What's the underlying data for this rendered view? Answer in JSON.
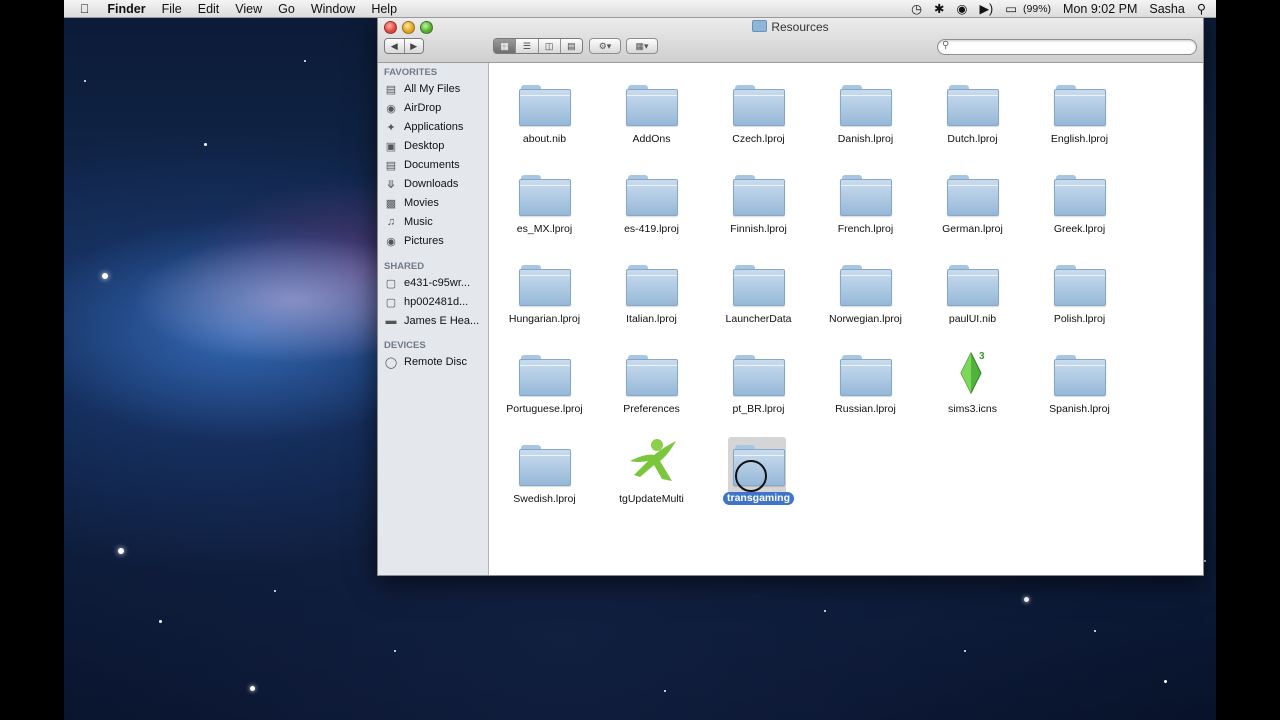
{
  "menubar": {
    "app": "Finder",
    "menus": [
      "File",
      "Edit",
      "View",
      "Go",
      "Window",
      "Help"
    ],
    "battery": "(99%)",
    "clock": "Mon 9:02 PM",
    "user": "Sasha"
  },
  "window": {
    "title": "Resources",
    "view_mode": "icon"
  },
  "sidebar": {
    "favorites_header": "FAVORITES",
    "favorites": [
      {
        "label": "All My Files",
        "icon": "all-files-icon"
      },
      {
        "label": "AirDrop",
        "icon": "airdrop-icon"
      },
      {
        "label": "Applications",
        "icon": "applications-icon"
      },
      {
        "label": "Desktop",
        "icon": "desktop-icon"
      },
      {
        "label": "Documents",
        "icon": "documents-icon"
      },
      {
        "label": "Downloads",
        "icon": "downloads-icon"
      },
      {
        "label": "Movies",
        "icon": "movies-icon"
      },
      {
        "label": "Music",
        "icon": "music-icon"
      },
      {
        "label": "Pictures",
        "icon": "pictures-icon"
      }
    ],
    "shared_header": "SHARED",
    "shared": [
      {
        "label": "e431-c95wr...",
        "icon": "computer-icon"
      },
      {
        "label": "hp002481d...",
        "icon": "computer-icon"
      },
      {
        "label": "James E Hea...",
        "icon": "server-icon"
      }
    ],
    "devices_header": "DEVICES",
    "devices": [
      {
        "label": "Remote Disc",
        "icon": "disc-icon"
      }
    ]
  },
  "files": [
    {
      "name": "about.nib",
      "kind": "folder"
    },
    {
      "name": "AddOns",
      "kind": "folder"
    },
    {
      "name": "Czech.lproj",
      "kind": "folder"
    },
    {
      "name": "Danish.lproj",
      "kind": "folder"
    },
    {
      "name": "Dutch.lproj",
      "kind": "folder"
    },
    {
      "name": "English.lproj",
      "kind": "folder"
    },
    {
      "name": "es_MX.lproj",
      "kind": "folder"
    },
    {
      "name": "es-419.lproj",
      "kind": "folder"
    },
    {
      "name": "Finnish.lproj",
      "kind": "folder"
    },
    {
      "name": "French.lproj",
      "kind": "folder"
    },
    {
      "name": "German.lproj",
      "kind": "folder"
    },
    {
      "name": "Greek.lproj",
      "kind": "folder"
    },
    {
      "name": "Hungarian.lproj",
      "kind": "folder"
    },
    {
      "name": "Italian.lproj",
      "kind": "folder"
    },
    {
      "name": "LauncherData",
      "kind": "folder"
    },
    {
      "name": "Norwegian.lproj",
      "kind": "folder"
    },
    {
      "name": "paulUI.nib",
      "kind": "folder"
    },
    {
      "name": "Polish.lproj",
      "kind": "folder"
    },
    {
      "name": "Portuguese.lproj",
      "kind": "folder"
    },
    {
      "name": "Preferences",
      "kind": "folder"
    },
    {
      "name": "pt_BR.lproj",
      "kind": "folder"
    },
    {
      "name": "Russian.lproj",
      "kind": "folder"
    },
    {
      "name": "sims3.icns",
      "kind": "sims-icon"
    },
    {
      "name": "Spanish.lproj",
      "kind": "folder"
    },
    {
      "name": "Swedish.lproj",
      "kind": "folder"
    },
    {
      "name": "tgUpdateMulti",
      "kind": "app"
    },
    {
      "name": "transgaming",
      "kind": "folder",
      "selected": true
    }
  ],
  "colors": {
    "selection": "#3e75c8",
    "folder": "#a9c6e0"
  }
}
